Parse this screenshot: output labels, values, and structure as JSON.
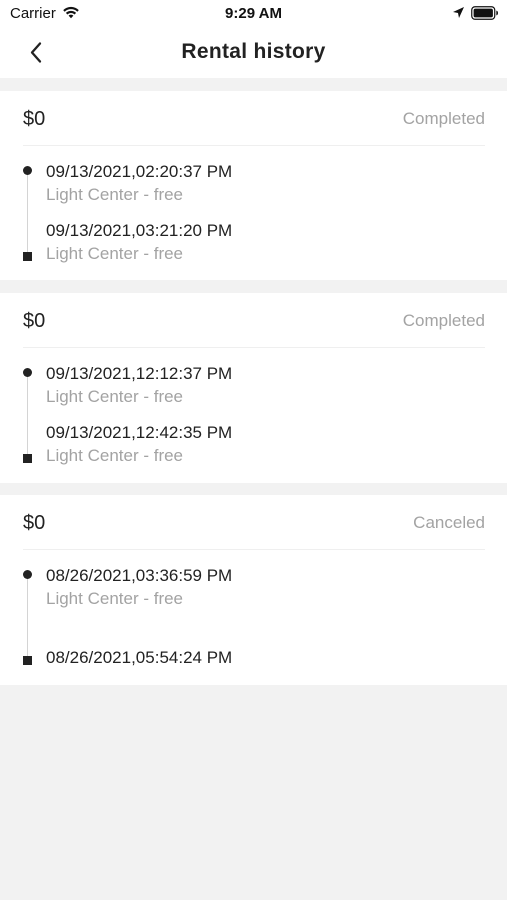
{
  "status_bar": {
    "carrier": "Carrier",
    "time": "9:29 AM"
  },
  "header": {
    "title": "Rental history"
  },
  "rentals": [
    {
      "amount": "$0",
      "status": "Completed",
      "start_time": "09/13/2021,02:20:37 PM",
      "start_location": "Light Center - free",
      "end_time": "09/13/2021,03:21:20 PM",
      "end_location": "Light Center - free"
    },
    {
      "amount": "$0",
      "status": "Completed",
      "start_time": "09/13/2021,12:12:37 PM",
      "start_location": "Light Center - free",
      "end_time": "09/13/2021,12:42:35 PM",
      "end_location": "Light Center - free"
    },
    {
      "amount": "$0",
      "status": "Canceled",
      "start_time": "08/26/2021,03:36:59 PM",
      "start_location": "Light Center - free",
      "end_time": "08/26/2021,05:54:24 PM"
    }
  ],
  "colors": {
    "background": "#f2f2f2",
    "card": "#ffffff",
    "text_primary": "#222222",
    "text_secondary": "#a3a3a3",
    "timeline": "#d4d4d4"
  }
}
